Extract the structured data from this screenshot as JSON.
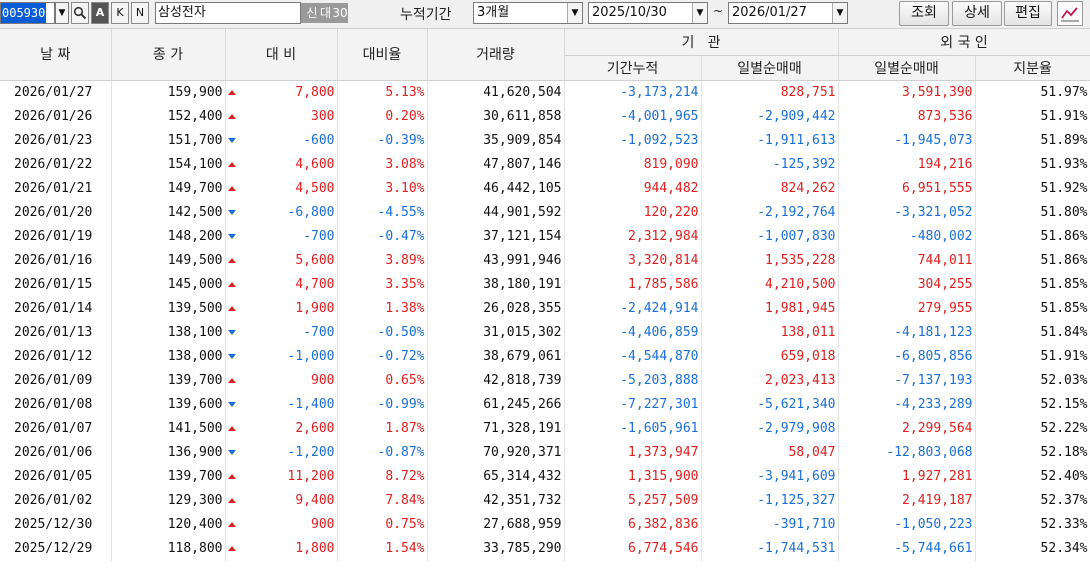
{
  "toolbar": {
    "code": "005930",
    "mode_a": "A",
    "mode_k": "K",
    "mode_n": "N",
    "stock_name": "삼성전자",
    "badge_1": "신",
    "badge_2": "대",
    "badge_3": "30",
    "period_label": "누적기간",
    "period_value": "3개월",
    "start_date": "2025/10/30",
    "tilde": "~",
    "end_date": "2026/01/27",
    "btn_query": "조회",
    "btn_detail": "상세",
    "btn_edit": "편집"
  },
  "headers": {
    "date": "날 짜",
    "close": "종 가",
    "change": "대 비",
    "change_rate": "대비율",
    "volume": "거래량",
    "institution": "기   관",
    "inst_cum": "기간누적",
    "inst_daily": "일별순매매",
    "foreign": "외 국 인",
    "for_daily": "일별순매매",
    "for_share": "지분율"
  },
  "rows": [
    {
      "date": "2026/01/27",
      "close": "159,900",
      "dir": "up",
      "change": "7,800",
      "rate": "5.13%",
      "volume": "41,620,504",
      "inst_cum": "-3,173,214",
      "inst_daily": "828,751",
      "for_daily": "3,591,390",
      "share": "51.97%"
    },
    {
      "date": "2026/01/26",
      "close": "152,400",
      "dir": "up",
      "change": "300",
      "rate": "0.20%",
      "volume": "30,611,858",
      "inst_cum": "-4,001,965",
      "inst_daily": "-2,909,442",
      "for_daily": "873,536",
      "share": "51.91%"
    },
    {
      "date": "2026/01/23",
      "close": "151,700",
      "dir": "down",
      "change": "-600",
      "rate": "-0.39%",
      "volume": "35,909,854",
      "inst_cum": "-1,092,523",
      "inst_daily": "-1,911,613",
      "for_daily": "-1,945,073",
      "share": "51.89%"
    },
    {
      "date": "2026/01/22",
      "close": "154,100",
      "dir": "up",
      "change": "4,600",
      "rate": "3.08%",
      "volume": "47,807,146",
      "inst_cum": "819,090",
      "inst_daily": "-125,392",
      "for_daily": "194,216",
      "share": "51.93%"
    },
    {
      "date": "2026/01/21",
      "close": "149,700",
      "dir": "up",
      "change": "4,500",
      "rate": "3.10%",
      "volume": "46,442,105",
      "inst_cum": "944,482",
      "inst_daily": "824,262",
      "for_daily": "6,951,555",
      "share": "51.92%"
    },
    {
      "date": "2026/01/20",
      "close": "142,500",
      "dir": "down",
      "change": "-6,800",
      "rate": "-4.55%",
      "volume": "44,901,592",
      "inst_cum": "120,220",
      "inst_daily": "-2,192,764",
      "for_daily": "-3,321,052",
      "share": "51.80%"
    },
    {
      "date": "2026/01/19",
      "close": "148,200",
      "dir": "down",
      "change": "-700",
      "rate": "-0.47%",
      "volume": "37,121,154",
      "inst_cum": "2,312,984",
      "inst_daily": "-1,007,830",
      "for_daily": "-480,002",
      "share": "51.86%"
    },
    {
      "date": "2026/01/16",
      "close": "149,500",
      "dir": "up",
      "change": "5,600",
      "rate": "3.89%",
      "volume": "43,991,946",
      "inst_cum": "3,320,814",
      "inst_daily": "1,535,228",
      "for_daily": "744,011",
      "share": "51.86%"
    },
    {
      "date": "2026/01/15",
      "close": "145,000",
      "dir": "up",
      "change": "4,700",
      "rate": "3.35%",
      "volume": "38,180,191",
      "inst_cum": "1,785,586",
      "inst_daily": "4,210,500",
      "for_daily": "304,255",
      "share": "51.85%"
    },
    {
      "date": "2026/01/14",
      "close": "139,500",
      "dir": "up",
      "change": "1,900",
      "rate": "1.38%",
      "volume": "26,028,355",
      "inst_cum": "-2,424,914",
      "inst_daily": "1,981,945",
      "for_daily": "279,955",
      "share": "51.85%"
    },
    {
      "date": "2026/01/13",
      "close": "138,100",
      "dir": "down",
      "change": "-700",
      "rate": "-0.50%",
      "volume": "31,015,302",
      "inst_cum": "-4,406,859",
      "inst_daily": "138,011",
      "for_daily": "-4,181,123",
      "share": "51.84%"
    },
    {
      "date": "2026/01/12",
      "close": "138,000",
      "dir": "down",
      "change": "-1,000",
      "rate": "-0.72%",
      "volume": "38,679,061",
      "inst_cum": "-4,544,870",
      "inst_daily": "659,018",
      "for_daily": "-6,805,856",
      "share": "51.91%"
    },
    {
      "date": "2026/01/09",
      "close": "139,700",
      "dir": "up",
      "change": "900",
      "rate": "0.65%",
      "volume": "42,818,739",
      "inst_cum": "-5,203,888",
      "inst_daily": "2,023,413",
      "for_daily": "-7,137,193",
      "share": "52.03%"
    },
    {
      "date": "2026/01/08",
      "close": "139,600",
      "dir": "down",
      "change": "-1,400",
      "rate": "-0.99%",
      "volume": "61,245,266",
      "inst_cum": "-7,227,301",
      "inst_daily": "-5,621,340",
      "for_daily": "-4,233,289",
      "share": "52.15%"
    },
    {
      "date": "2026/01/07",
      "close": "141,500",
      "dir": "up",
      "change": "2,600",
      "rate": "1.87%",
      "volume": "71,328,191",
      "inst_cum": "-1,605,961",
      "inst_daily": "-2,979,908",
      "for_daily": "2,299,564",
      "share": "52.22%"
    },
    {
      "date": "2026/01/06",
      "close": "136,900",
      "dir": "down",
      "change": "-1,200",
      "rate": "-0.87%",
      "volume": "70,920,371",
      "inst_cum": "1,373,947",
      "inst_daily": "58,047",
      "for_daily": "-12,803,068",
      "share": "52.18%"
    },
    {
      "date": "2026/01/05",
      "close": "139,700",
      "dir": "up",
      "change": "11,200",
      "rate": "8.72%",
      "volume": "65,314,432",
      "inst_cum": "1,315,900",
      "inst_daily": "-3,941,609",
      "for_daily": "1,927,281",
      "share": "52.40%"
    },
    {
      "date": "2026/01/02",
      "close": "129,300",
      "dir": "up",
      "change": "9,400",
      "rate": "7.84%",
      "volume": "42,351,732",
      "inst_cum": "5,257,509",
      "inst_daily": "-1,125,327",
      "for_daily": "2,419,187",
      "share": "52.37%"
    },
    {
      "date": "2025/12/30",
      "close": "120,400",
      "dir": "up",
      "change": "900",
      "rate": "0.75%",
      "volume": "27,688,959",
      "inst_cum": "6,382,836",
      "inst_daily": "-391,710",
      "for_daily": "-1,050,223",
      "share": "52.33%"
    },
    {
      "date": "2025/12/29",
      "close": "118,800",
      "dir": "up",
      "change": "1,800",
      "rate": "1.54%",
      "volume": "33,785,290",
      "inst_cum": "6,774,546",
      "inst_daily": "-1,744,531",
      "for_daily": "-5,744,661",
      "share": "52.34%"
    }
  ],
  "colors": {
    "up": "#e02020",
    "down": "#1a6fd6"
  }
}
